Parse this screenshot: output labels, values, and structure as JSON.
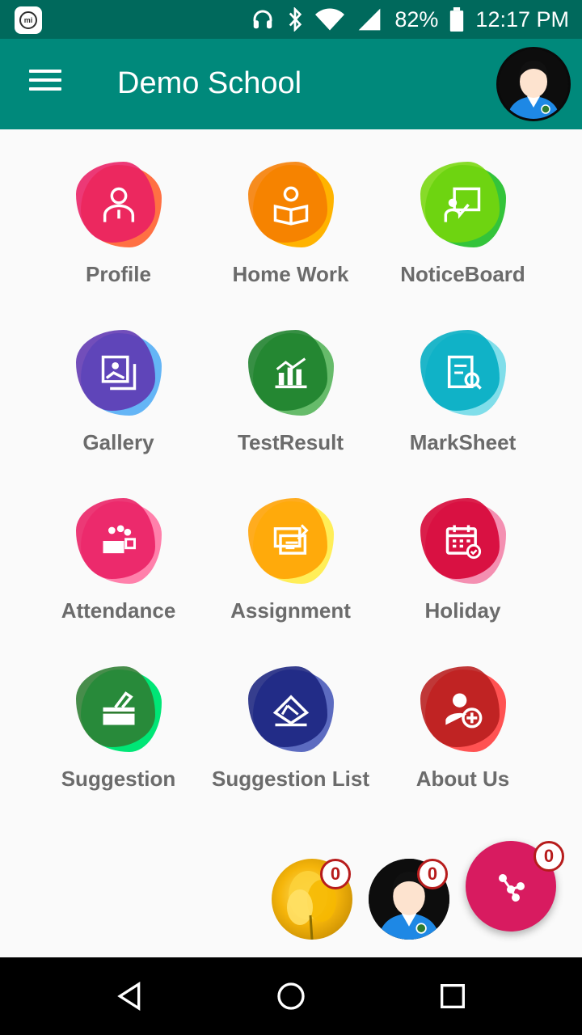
{
  "status_bar": {
    "battery": "82%",
    "time": "12:17 PM",
    "icons": [
      "mi-icon",
      "headphones-icon",
      "bluetooth-icon",
      "wifi-icon",
      "signal-icon",
      "battery-icon"
    ]
  },
  "app_bar": {
    "title": "Demo School",
    "menu_icon": "hamburger-icon",
    "avatar": "user-avatar"
  },
  "tiles": [
    {
      "label": "Profile",
      "icon": "profile-icon",
      "colors": [
        "#e91e63",
        "#ff7043"
      ]
    },
    {
      "label": "Home Work",
      "icon": "homework-icon",
      "colors": [
        "#ff9800",
        "#f57c00"
      ]
    },
    {
      "label": "NoticeBoard",
      "icon": "noticeboard-icon",
      "colors": [
        "#76d60b",
        "#33c43a"
      ]
    },
    {
      "label": "Gallery",
      "icon": "gallery-icon",
      "colors": [
        "#3f51b5",
        "#7b1fa2"
      ]
    },
    {
      "label": "TestResult",
      "icon": "test-result-icon",
      "colors": [
        "#43a047",
        "#1b7f2a"
      ]
    },
    {
      "label": "MarkSheet",
      "icon": "marksheet-icon",
      "colors": [
        "#26c6da",
        "#00acc1"
      ]
    },
    {
      "label": "Attendance",
      "icon": "attendance-icon",
      "colors": [
        "#f06292",
        "#e91e63"
      ]
    },
    {
      "label": "Assignment",
      "icon": "assignment-icon",
      "colors": [
        "#ffd600",
        "#ffa000"
      ]
    },
    {
      "label": "Holiday",
      "icon": "calendar-icon",
      "colors": [
        "#e91e63",
        "#c2185b"
      ]
    },
    {
      "label": "Suggestion",
      "icon": "suggestion-box-icon",
      "colors": [
        "#2e7d32",
        "#00c853"
      ]
    },
    {
      "label": "Suggestion List",
      "icon": "suggestion-list-icon",
      "colors": [
        "#1a237e",
        "#3949ab"
      ]
    },
    {
      "label": "About Us",
      "icon": "about-us-icon",
      "colors": [
        "#e53935",
        "#c62828"
      ]
    }
  ],
  "fab": {
    "flower_badge": "0",
    "avatar_badge": "0",
    "main_badge": "0"
  },
  "nav_bar": {
    "icons": [
      "back-icon",
      "home-icon",
      "recents-icon"
    ]
  }
}
